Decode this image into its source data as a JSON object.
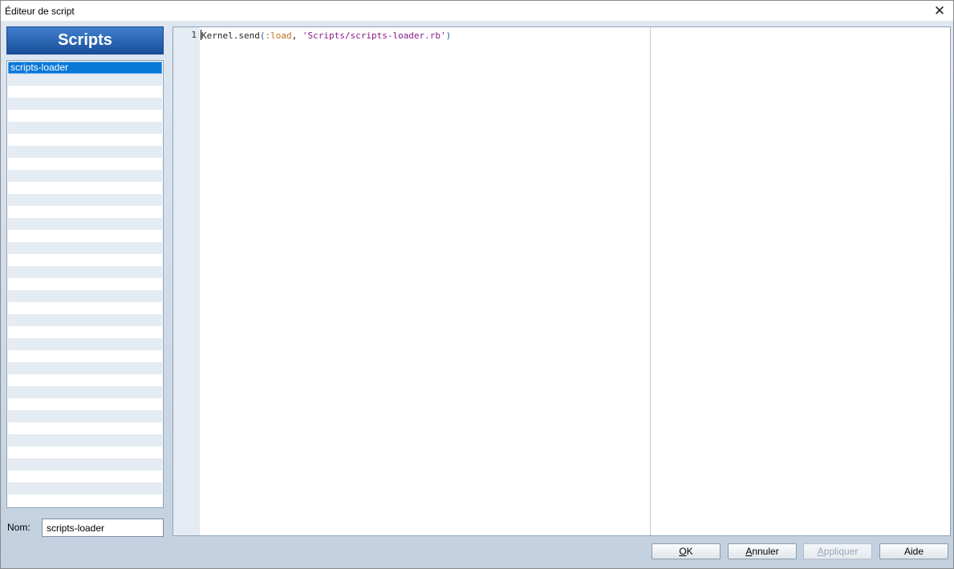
{
  "window": {
    "title": "Éditeur de script",
    "close_glyph": "✕"
  },
  "scripts_panel": {
    "header": "Scripts",
    "items": [
      {
        "label": "scripts-loader",
        "selected": true
      }
    ],
    "empty_row_count": 36
  },
  "name_field": {
    "label": "Nom:",
    "value": "scripts-loader"
  },
  "editor": {
    "line_number": "1",
    "tokens": [
      {
        "text": "Kernel.send",
        "kind": "plain"
      },
      {
        "text": "(",
        "kind": "paren"
      },
      {
        "text": ":load",
        "kind": "symbol"
      },
      {
        "text": ", ",
        "kind": "plain"
      },
      {
        "text": "'Scripts/scripts-loader.rb'",
        "kind": "string"
      },
      {
        "text": ")",
        "kind": "paren"
      }
    ]
  },
  "buttons": {
    "ok": {
      "mnemonic": "O",
      "rest": "K"
    },
    "cancel": {
      "mnemonic": "A",
      "rest": "nnuler"
    },
    "apply": {
      "mnemonic": "A",
      "rest": "ppliquer",
      "enabled": false
    },
    "help": {
      "label": "Aide"
    }
  },
  "colors": {
    "accent": "#0a78d7",
    "header_gradient_top": "#3f7fcf",
    "header_gradient_bottom": "#1a4f9a",
    "symbol": "#c0701a",
    "string": "#8a1a8a",
    "paren": "#2b57a6"
  }
}
